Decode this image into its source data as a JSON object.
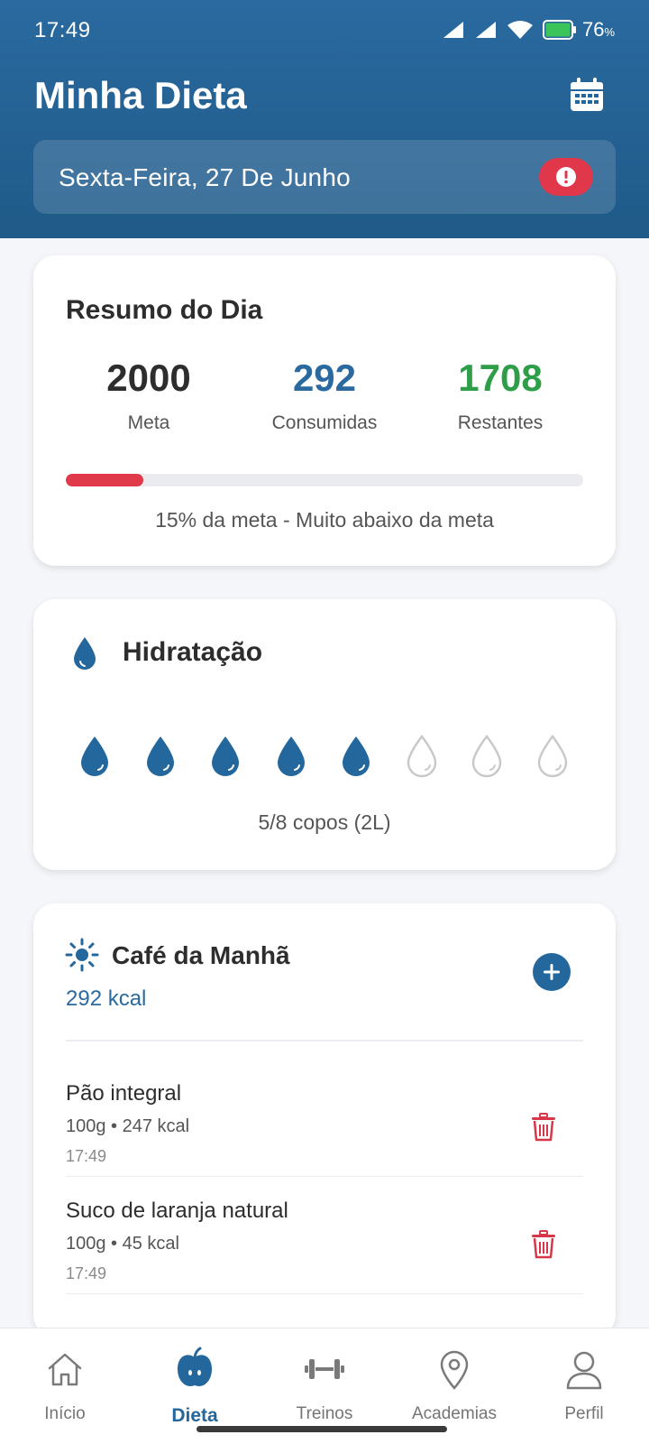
{
  "status_bar": {
    "time": "17:49",
    "battery_percent": "76",
    "battery_unit": "%"
  },
  "header": {
    "title": "Minha Dieta",
    "calendar_icon": "calendar-icon",
    "date": "Sexta-Feira, 27 De Junho",
    "alert_icon": "exclamation-circle-icon"
  },
  "summary": {
    "title": "Resumo do Dia",
    "goal_value": "2000",
    "goal_label": "Meta",
    "consumed_value": "292",
    "consumed_label": "Consumidas",
    "remaining_value": "1708",
    "remaining_label": "Restantes",
    "progress_fraction": 0.15,
    "progress_caption": "15% da meta - Muito abaixo da meta",
    "colors": {
      "consumed": "#2a6aa0",
      "remaining": "#2e9e49",
      "progress": "#e03a4a"
    }
  },
  "hydration": {
    "title": "Hidratação",
    "icon": "water-drop-icon",
    "filled_cups": 5,
    "total_cups": 8,
    "caption": "5/8 copos (2L)"
  },
  "meal": {
    "title": "Café da Manhã",
    "icon": "sun-icon",
    "kcal": "292 kcal",
    "add_icon": "plus-icon",
    "items": [
      {
        "name": "Pão integral",
        "detail": "100g • 247 kcal",
        "time": "17:49"
      },
      {
        "name": "Suco de laranja natural",
        "detail": "100g • 45 kcal",
        "time": "17:49"
      }
    ]
  },
  "bottom_nav": {
    "items": [
      {
        "label": "Início",
        "icon": "home-icon"
      },
      {
        "label": "Dieta",
        "icon": "apple-icon",
        "active": true
      },
      {
        "label": "Treinos",
        "icon": "dumbbell-icon"
      },
      {
        "label": "Academias",
        "icon": "location-pin-icon"
      },
      {
        "label": "Perfil",
        "icon": "user-icon"
      }
    ]
  }
}
